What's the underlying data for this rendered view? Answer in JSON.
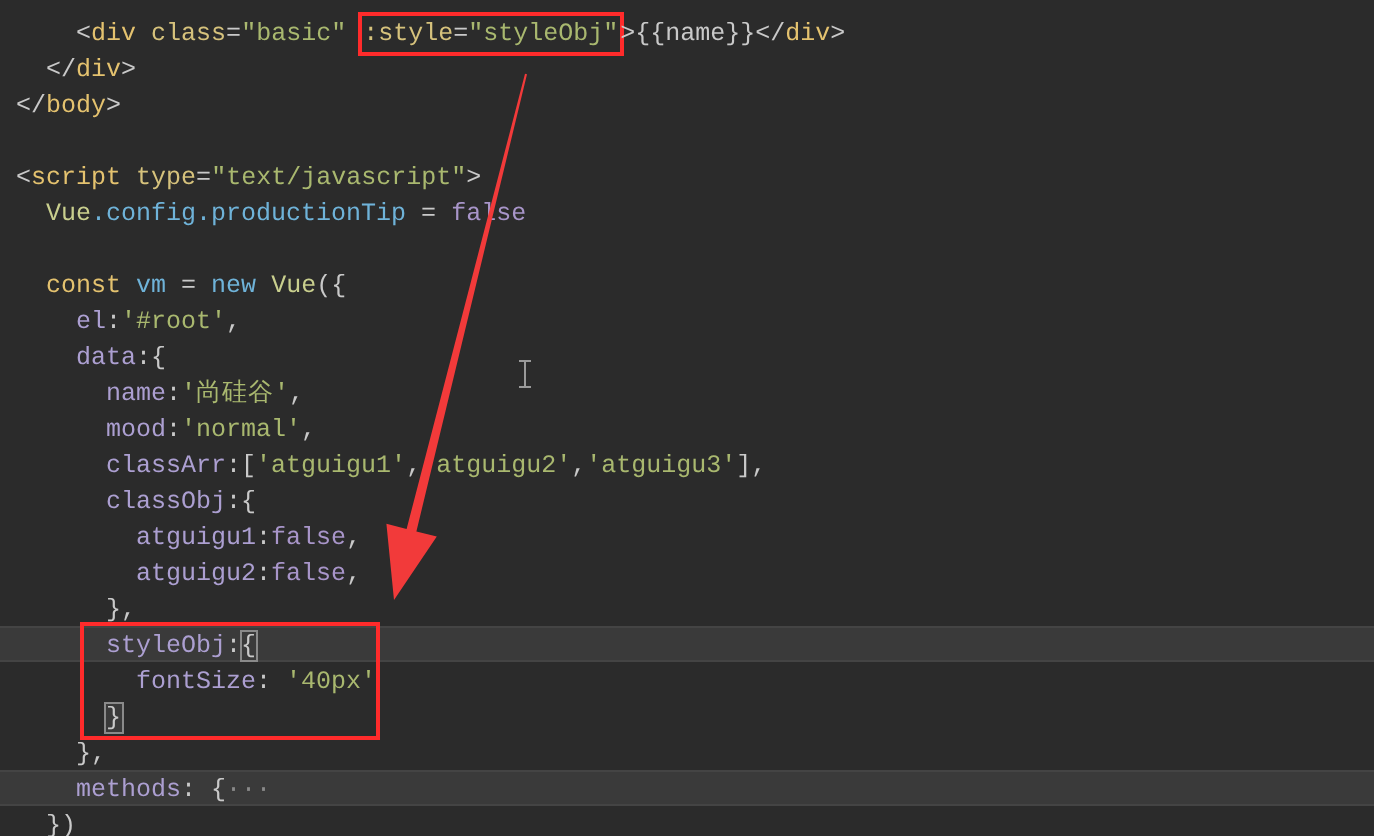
{
  "editor": {
    "lines": [
      {
        "highlighted": false,
        "tokens": [
          {
            "kind": "punct",
            "text": "    <"
          },
          {
            "kind": "tag",
            "text": "div"
          },
          {
            "kind": "attr",
            "text": " class"
          },
          {
            "kind": "punct",
            "text": "="
          },
          {
            "kind": "string",
            "text": "\"basic\" "
          },
          {
            "kind": "boxed",
            "tokens": [
              {
                "kind": "attr",
                "text": ":style"
              },
              {
                "kind": "punct",
                "text": "="
              },
              {
                "kind": "string",
                "text": "\"styleObj\""
              }
            ]
          },
          {
            "kind": "punct",
            "text": ">{{name}}</"
          },
          {
            "kind": "tag",
            "text": "div"
          },
          {
            "kind": "punct",
            "text": ">"
          }
        ]
      },
      {
        "highlighted": false,
        "tokens": [
          {
            "kind": "punct",
            "text": "  </"
          },
          {
            "kind": "tag",
            "text": "div"
          },
          {
            "kind": "punct",
            "text": ">"
          }
        ]
      },
      {
        "highlighted": false,
        "tokens": [
          {
            "kind": "punct",
            "text": "</"
          },
          {
            "kind": "tag",
            "text": "body"
          },
          {
            "kind": "punct",
            "text": ">"
          }
        ]
      },
      {
        "highlighted": false,
        "kind": "blank"
      },
      {
        "highlighted": false,
        "tokens": [
          {
            "kind": "punct",
            "text": "<"
          },
          {
            "kind": "tag",
            "text": "script"
          },
          {
            "kind": "attr",
            "text": " type"
          },
          {
            "kind": "punct",
            "text": "="
          },
          {
            "kind": "string",
            "text": "\"text/javascript\""
          },
          {
            "kind": "punct",
            "text": ">"
          }
        ]
      },
      {
        "highlighted": false,
        "tokens": [
          {
            "kind": "class",
            "text": "  Vue"
          },
          {
            "kind": "member",
            "text": ".config.productionTip"
          },
          {
            "kind": "punct",
            "text": " = "
          },
          {
            "kind": "bool",
            "text": "false"
          }
        ]
      },
      {
        "highlighted": false,
        "kind": "blank"
      },
      {
        "highlighted": false,
        "tokens": [
          {
            "kind": "keyword",
            "text": "  const"
          },
          {
            "kind": "member",
            "text": " vm"
          },
          {
            "kind": "punct",
            "text": " = "
          },
          {
            "kind": "member",
            "text": "new"
          },
          {
            "kind": "class",
            "text": " Vue"
          },
          {
            "kind": "punct",
            "text": "({"
          }
        ]
      },
      {
        "highlighted": false,
        "tokens": [
          {
            "kind": "field",
            "text": "    el"
          },
          {
            "kind": "punct",
            "text": ":"
          },
          {
            "kind": "string",
            "text": "'#root'"
          },
          {
            "kind": "punct",
            "text": ","
          }
        ]
      },
      {
        "highlighted": false,
        "tokens": [
          {
            "kind": "field",
            "text": "    data"
          },
          {
            "kind": "punct",
            "text": ":{"
          }
        ]
      },
      {
        "highlighted": false,
        "tokens": [
          {
            "kind": "field",
            "text": "      name"
          },
          {
            "kind": "punct",
            "text": ":"
          },
          {
            "kind": "string",
            "text": "'尚硅谷'"
          },
          {
            "kind": "punct",
            "text": ","
          }
        ]
      },
      {
        "highlighted": false,
        "tokens": [
          {
            "kind": "field",
            "text": "      mood"
          },
          {
            "kind": "punct",
            "text": ":"
          },
          {
            "kind": "string",
            "text": "'normal'"
          },
          {
            "kind": "punct",
            "text": ","
          }
        ]
      },
      {
        "highlighted": false,
        "tokens": [
          {
            "kind": "field",
            "text": "      classArr"
          },
          {
            "kind": "punct",
            "text": ":["
          },
          {
            "kind": "string",
            "text": "'atguigu1'"
          },
          {
            "kind": "punct",
            "text": ","
          },
          {
            "kind": "string",
            "text": " atguigu2'"
          },
          {
            "kind": "punct",
            "text": ","
          },
          {
            "kind": "string",
            "text": "'atguigu3'"
          },
          {
            "kind": "punct",
            "text": "],"
          }
        ]
      },
      {
        "highlighted": false,
        "tokens": [
          {
            "kind": "field",
            "text": "      classObj"
          },
          {
            "kind": "punct",
            "text": ":{"
          }
        ]
      },
      {
        "highlighted": false,
        "tokens": [
          {
            "kind": "field",
            "text": "        atguigu1"
          },
          {
            "kind": "punct",
            "text": ":"
          },
          {
            "kind": "bool",
            "text": "false"
          },
          {
            "kind": "punct",
            "text": ","
          }
        ]
      },
      {
        "highlighted": false,
        "tokens": [
          {
            "kind": "field",
            "text": "        atguigu2"
          },
          {
            "kind": "punct",
            "text": ":"
          },
          {
            "kind": "bool",
            "text": "false"
          },
          {
            "kind": "punct",
            "text": ","
          }
        ]
      },
      {
        "highlighted": false,
        "tokens": [
          {
            "kind": "punct",
            "text": "      },"
          }
        ]
      },
      {
        "kind": "boxed_block",
        "lines": [
          {
            "highlighted": true,
            "tokens": [
              {
                "kind": "field",
                "text": "      styleObj"
              },
              {
                "kind": "punct",
                "text": ":"
              },
              {
                "kind": "match",
                "text": "{"
              }
            ]
          },
          {
            "highlighted": false,
            "tokens": [
              {
                "kind": "field",
                "text": "        fontSize"
              },
              {
                "kind": "punct",
                "text": ": "
              },
              {
                "kind": "string",
                "text": "'40px'"
              }
            ]
          },
          {
            "highlighted": false,
            "tokens": [
              {
                "kind": "match",
                "text": "      }"
              }
            ]
          }
        ]
      },
      {
        "highlighted": false,
        "tokens": [
          {
            "kind": "punct",
            "text": "    },"
          }
        ]
      },
      {
        "highlighted": true,
        "tokens": [
          {
            "kind": "field",
            "text": "    methods"
          },
          {
            "kind": "punct",
            "text": ": {"
          },
          {
            "kind": "fold",
            "text": "···"
          }
        ]
      },
      {
        "highlighted": false,
        "tokens": [
          {
            "kind": "punct",
            "text": "  })"
          }
        ]
      }
    ]
  }
}
